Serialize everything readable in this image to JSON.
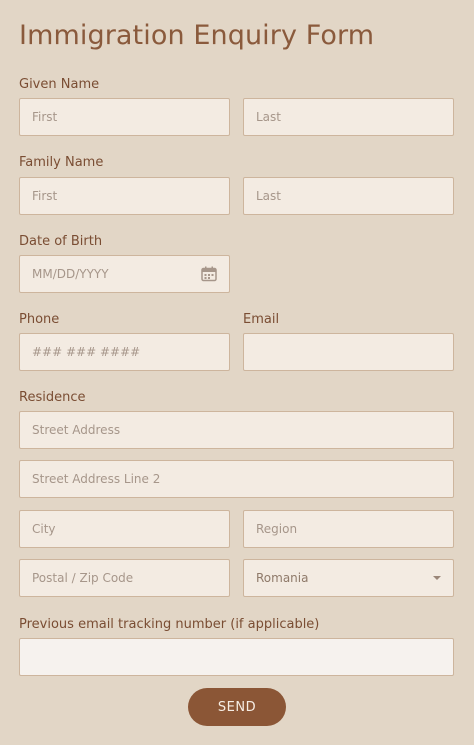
{
  "title": "Immigration Enquiry Form",
  "given_name": {
    "label": "Given Name",
    "first_placeholder": "First",
    "last_placeholder": "Last"
  },
  "family_name": {
    "label": "Family Name",
    "first_placeholder": "First",
    "last_placeholder": "Last"
  },
  "dob": {
    "label": "Date of Birth",
    "placeholder": "MM/DD/YYYY",
    "icon": "calendar-icon"
  },
  "phone": {
    "label": "Phone",
    "placeholder": "### ### ####"
  },
  "email": {
    "label": "Email",
    "value": ""
  },
  "residence": {
    "label": "Residence",
    "street_placeholder": "Street Address",
    "street2_placeholder": "Street Address Line 2",
    "city_placeholder": "City",
    "region_placeholder": "Region",
    "postal_placeholder": "Postal / Zip Code",
    "country_selected": "Romania"
  },
  "tracking": {
    "label": "Previous email tracking number (if applicable)",
    "value": ""
  },
  "send_label": "SEND",
  "colors": {
    "background": "#e2d6c6",
    "field": "#f3ebe2",
    "border": "#cdb59d",
    "button": "#8b5636",
    "text": "#7a4d33"
  }
}
